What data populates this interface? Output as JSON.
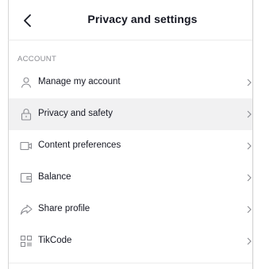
{
  "header": {
    "title": "Privacy and settings",
    "back_icon": "chevron-left-icon"
  },
  "section": {
    "label": "ACCOUNT"
  },
  "items": [
    {
      "label": "Manage my account",
      "icon": "person-icon"
    },
    {
      "label": "Privacy and safety",
      "icon": "lock-icon"
    },
    {
      "label": "Content preferences",
      "icon": "video-icon"
    },
    {
      "label": "Balance",
      "icon": "wallet-icon"
    },
    {
      "label": "Share profile",
      "icon": "share-icon"
    },
    {
      "label": "TikCode",
      "icon": "qr-code-icon"
    }
  ],
  "colors": {
    "text": "#161823",
    "muted": "#8a8b91",
    "active_row": "#f1f1f2"
  }
}
